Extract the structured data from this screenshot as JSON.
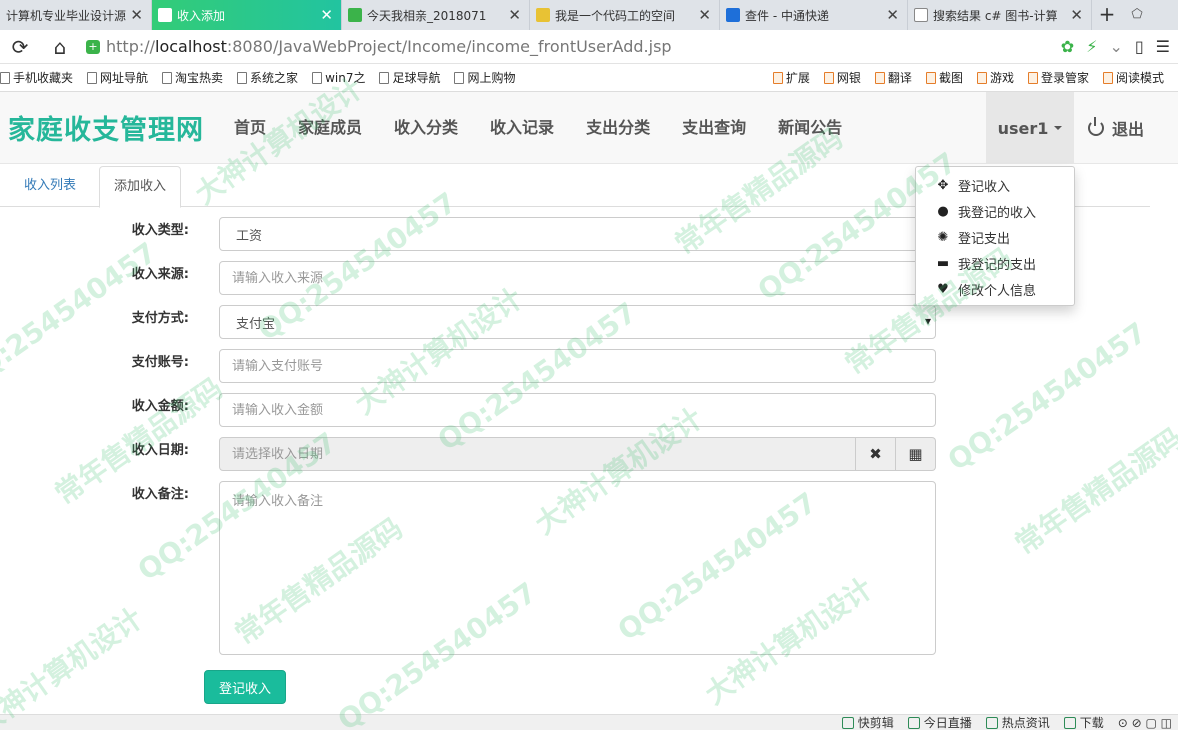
{
  "browser": {
    "tabs": [
      {
        "title": "计算机专业毕业设计源",
        "active": false
      },
      {
        "title": "收入添加",
        "active": true
      },
      {
        "title": "今天我相亲_2018071",
        "active": false
      },
      {
        "title": "我是一个代码工的空间",
        "active": false
      },
      {
        "title": "查件 - 中通快递",
        "active": false
      },
      {
        "title": "搜索结果 c# 图书-计算",
        "active": false
      }
    ],
    "new_tab": "+",
    "url_prefix": "http://",
    "url_host": "localhost",
    "url_rest": ":8080/JavaWebProject/Income/income_frontUserAdd.jsp",
    "bookmarks": [
      "手机收藏夹",
      "网址导航",
      "淘宝热卖",
      "系统之家",
      "win7之",
      "足球导航",
      "网上购物"
    ],
    "bookmarks_right": [
      "扩展",
      "网银",
      "翻译",
      "截图",
      "游戏",
      "登录管家",
      "阅读模式"
    ]
  },
  "site": {
    "brand": "家庭收支管理网",
    "menu": [
      "首页",
      "家庭成员",
      "收入分类",
      "收入记录",
      "支出分类",
      "支出查询",
      "新闻公告"
    ],
    "user": "user1",
    "logout": "退出"
  },
  "dropdown": {
    "items": [
      {
        "label": "登记收入",
        "icon": "move-icon"
      },
      {
        "label": "我登记的收入",
        "icon": "user-icon"
      },
      {
        "label": "登记支出",
        "icon": "cog-icon"
      },
      {
        "label": "我登记的支出",
        "icon": "credit-card-icon"
      },
      {
        "label": "修改个人信息",
        "icon": "heart-icon"
      }
    ]
  },
  "tabs": {
    "list": "收入列表",
    "add": "添加收入"
  },
  "form": {
    "type_label": "收入类型:",
    "type_value": "工资",
    "source_label": "收入来源:",
    "source_placeholder": "请输入收入来源",
    "pay_label": "支付方式:",
    "pay_value": "支付宝",
    "account_label": "支付账号:",
    "account_placeholder": "请输入支付账号",
    "amount_label": "收入金额:",
    "amount_placeholder": "请输入收入金额",
    "date_label": "收入日期:",
    "date_placeholder": "请选择收入日期",
    "memo_label": "收入备注:",
    "memo_placeholder": "请输入收入备注",
    "submit": "登记收入"
  },
  "statusbar": [
    "快剪辑",
    "今日直播",
    "热点资讯",
    "下载"
  ],
  "watermark": [
    "QQ:254540457",
    "大神计算机设计",
    "常年售精品源码"
  ]
}
